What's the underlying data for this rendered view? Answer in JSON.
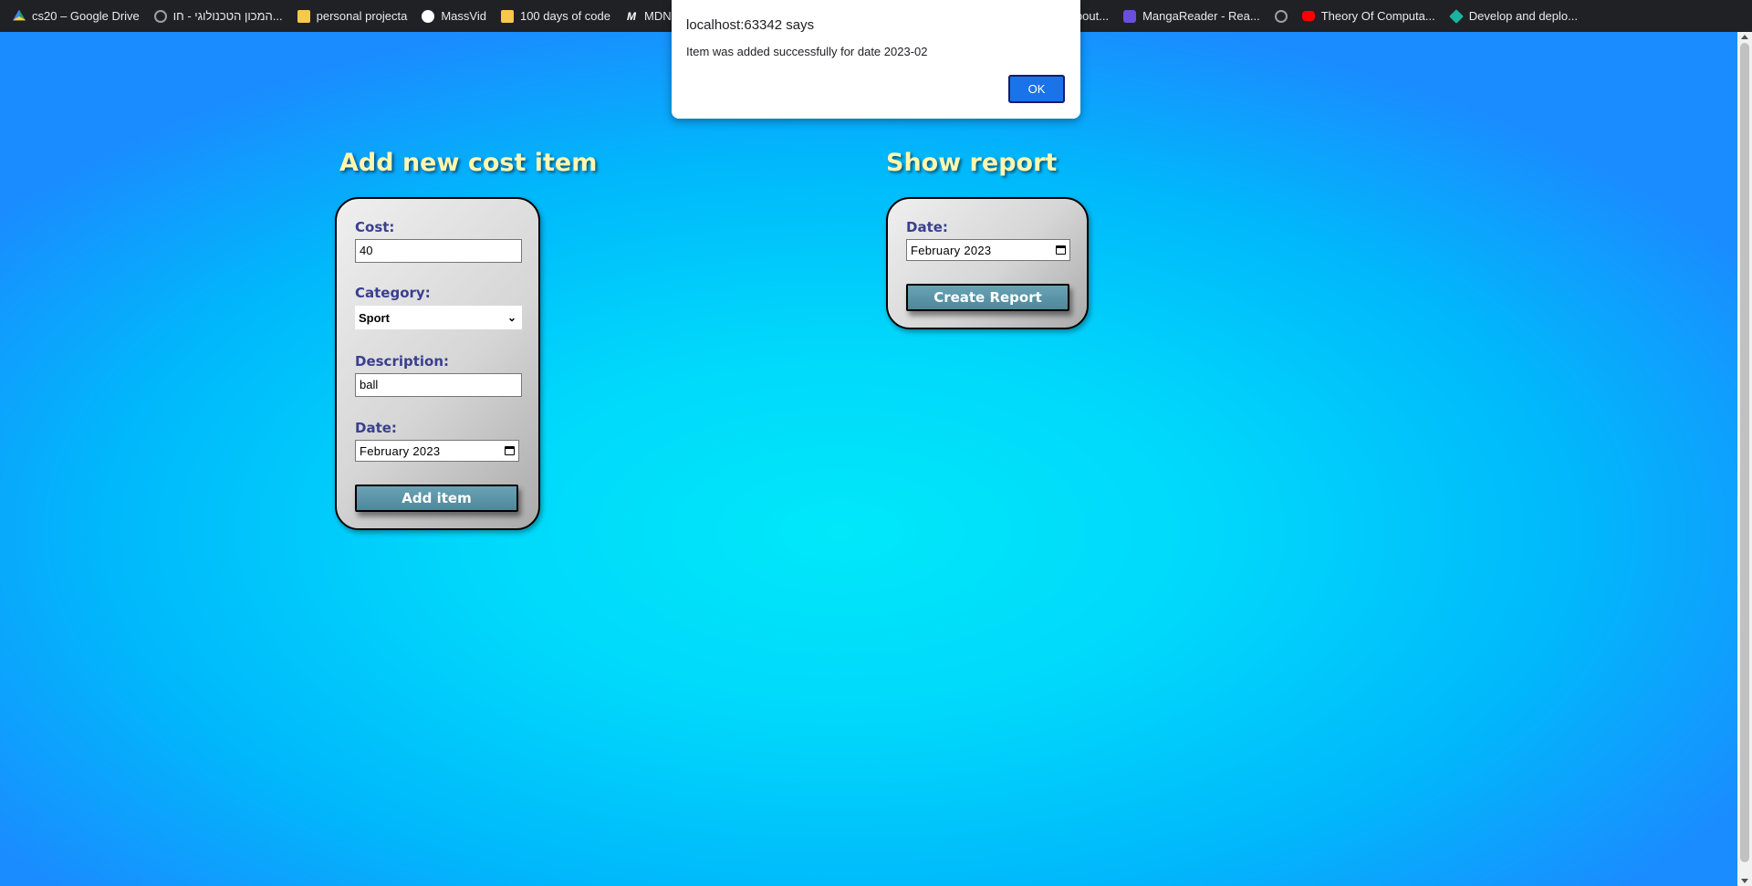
{
  "bookmarks": [
    {
      "icon": "google-drive-icon",
      "label": "cs20 – Google Drive"
    },
    {
      "icon": "globe-icon",
      "label": "המכון הטכנולוגי - חו..."
    },
    {
      "icon": "folder-icon",
      "label": "personal projecta"
    },
    {
      "icon": "massvid-icon",
      "label": "MassVid"
    },
    {
      "icon": "folder-icon",
      "label": "100 days of code"
    },
    {
      "icon": "mdn-icon",
      "label": "MDN Web"
    },
    {
      "icon": "globe-icon",
      "label": "about..."
    },
    {
      "icon": "mangareader-icon",
      "label": "MangaReader - Rea..."
    },
    {
      "icon": "globe-icon",
      "label": ""
    },
    {
      "icon": "youtube-icon",
      "label": "Theory Of Computa..."
    },
    {
      "icon": "develop-icon",
      "label": "Develop and deplo..."
    }
  ],
  "dialog": {
    "title": "localhost:63342 says",
    "message": "Item was added successfully for date 2023-02",
    "ok_label": "OK"
  },
  "add_item": {
    "title": "Add new cost item",
    "cost_label": "Cost:",
    "cost_value": "40",
    "category_label": "Category:",
    "category_value": "Sport",
    "description_label": "Description:",
    "description_value": "ball",
    "date_label": "Date:",
    "date_value": "February 2023",
    "button_label": "Add item"
  },
  "report": {
    "title": "Show report",
    "date_label": "Date:",
    "date_value": "February 2023",
    "button_label": "Create Report"
  }
}
